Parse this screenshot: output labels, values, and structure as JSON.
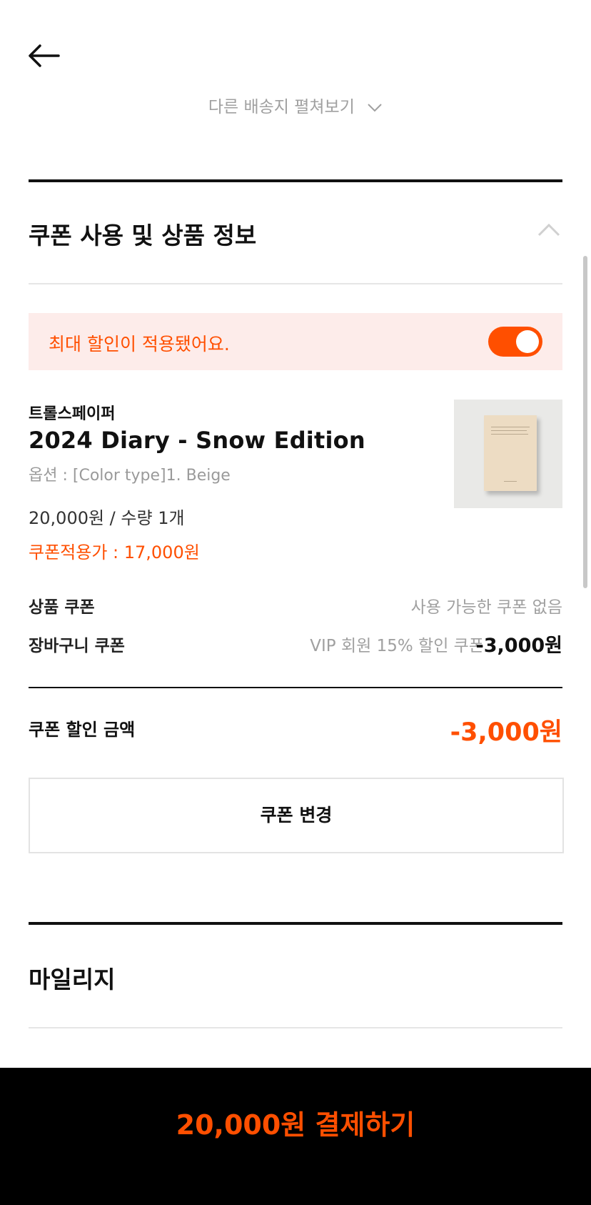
{
  "header": {
    "back_icon": "arrow-left-icon",
    "other_address_label": "다른 배송지 펼쳐보기",
    "other_address_icon": "chevron-down-icon"
  },
  "coupon_section": {
    "title": "쿠폰 사용 및 상품 정보",
    "collapse_icon": "chevron-up-icon",
    "banner": {
      "text": "최대 할인이 적용됐어요.",
      "toggle_on": true
    },
    "product": {
      "brand": "트롤스페이퍼",
      "name": "2024 Diary - Snow Edition",
      "option": "옵션 : [Color type]1. Beige",
      "price_qty": "20,000원 / 수량 1개",
      "coupon_price": "쿠폰적용가 : 17,000원"
    },
    "product_coupon": {
      "label": "상품 쿠폰",
      "value": "사용 가능한 쿠폰 없음"
    },
    "cart_coupon": {
      "label": "장바구니 쿠폰",
      "description": "VIP 회원 15% 할인 쿠폰",
      "amount": "-3,000원"
    },
    "discount": {
      "label": "쿠폰 할인 금액",
      "amount": "-3,000원"
    },
    "change_button": "쿠폰 변경"
  },
  "mileage_section": {
    "title": "마일리지"
  },
  "pay_button": {
    "label": "20,000원 결제하기"
  },
  "colors": {
    "accent": "#ff4f00",
    "banner_bg": "#fdecea",
    "muted_text": "#a0a0a0",
    "pay_bar_bg": "#000000"
  }
}
